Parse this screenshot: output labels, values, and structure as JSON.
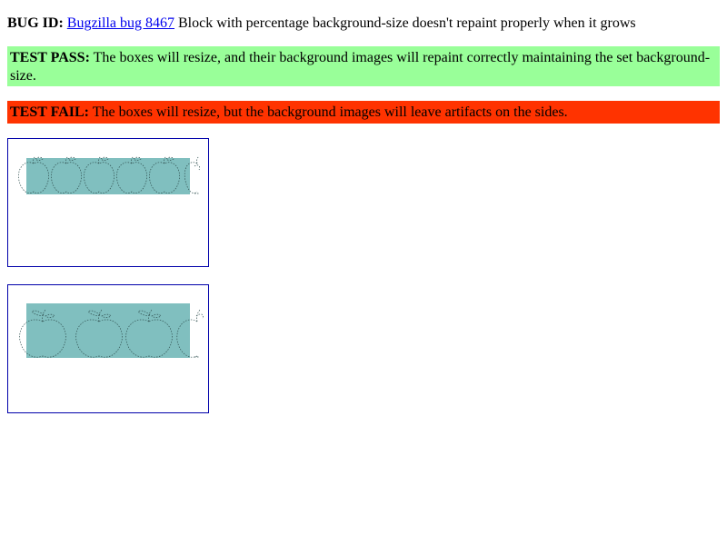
{
  "bug": {
    "label": "BUG ID:",
    "link_text": "Bugzilla bug 8467",
    "description": " Block with percentage background-size doesn't repaint properly when it grows"
  },
  "pass": {
    "label": "TEST PASS:",
    "text": " The boxes will resize, and their background images will repaint correctly maintaining the set background-size."
  },
  "fail": {
    "label": "TEST FAIL:",
    "text": " The boxes will resize, but the background images will leave artifacts on the sides."
  },
  "colors": {
    "pass_bg": "#99ff99",
    "fail_bg": "#ff3300",
    "box_border": "#0000aa",
    "tile_fill": "#80bfbf",
    "link": "#0000ee"
  },
  "boxes": [
    {
      "icon": "apple-icon",
      "tile_count": 4
    },
    {
      "icon": "apple-icon",
      "tile_count": 4
    }
  ]
}
